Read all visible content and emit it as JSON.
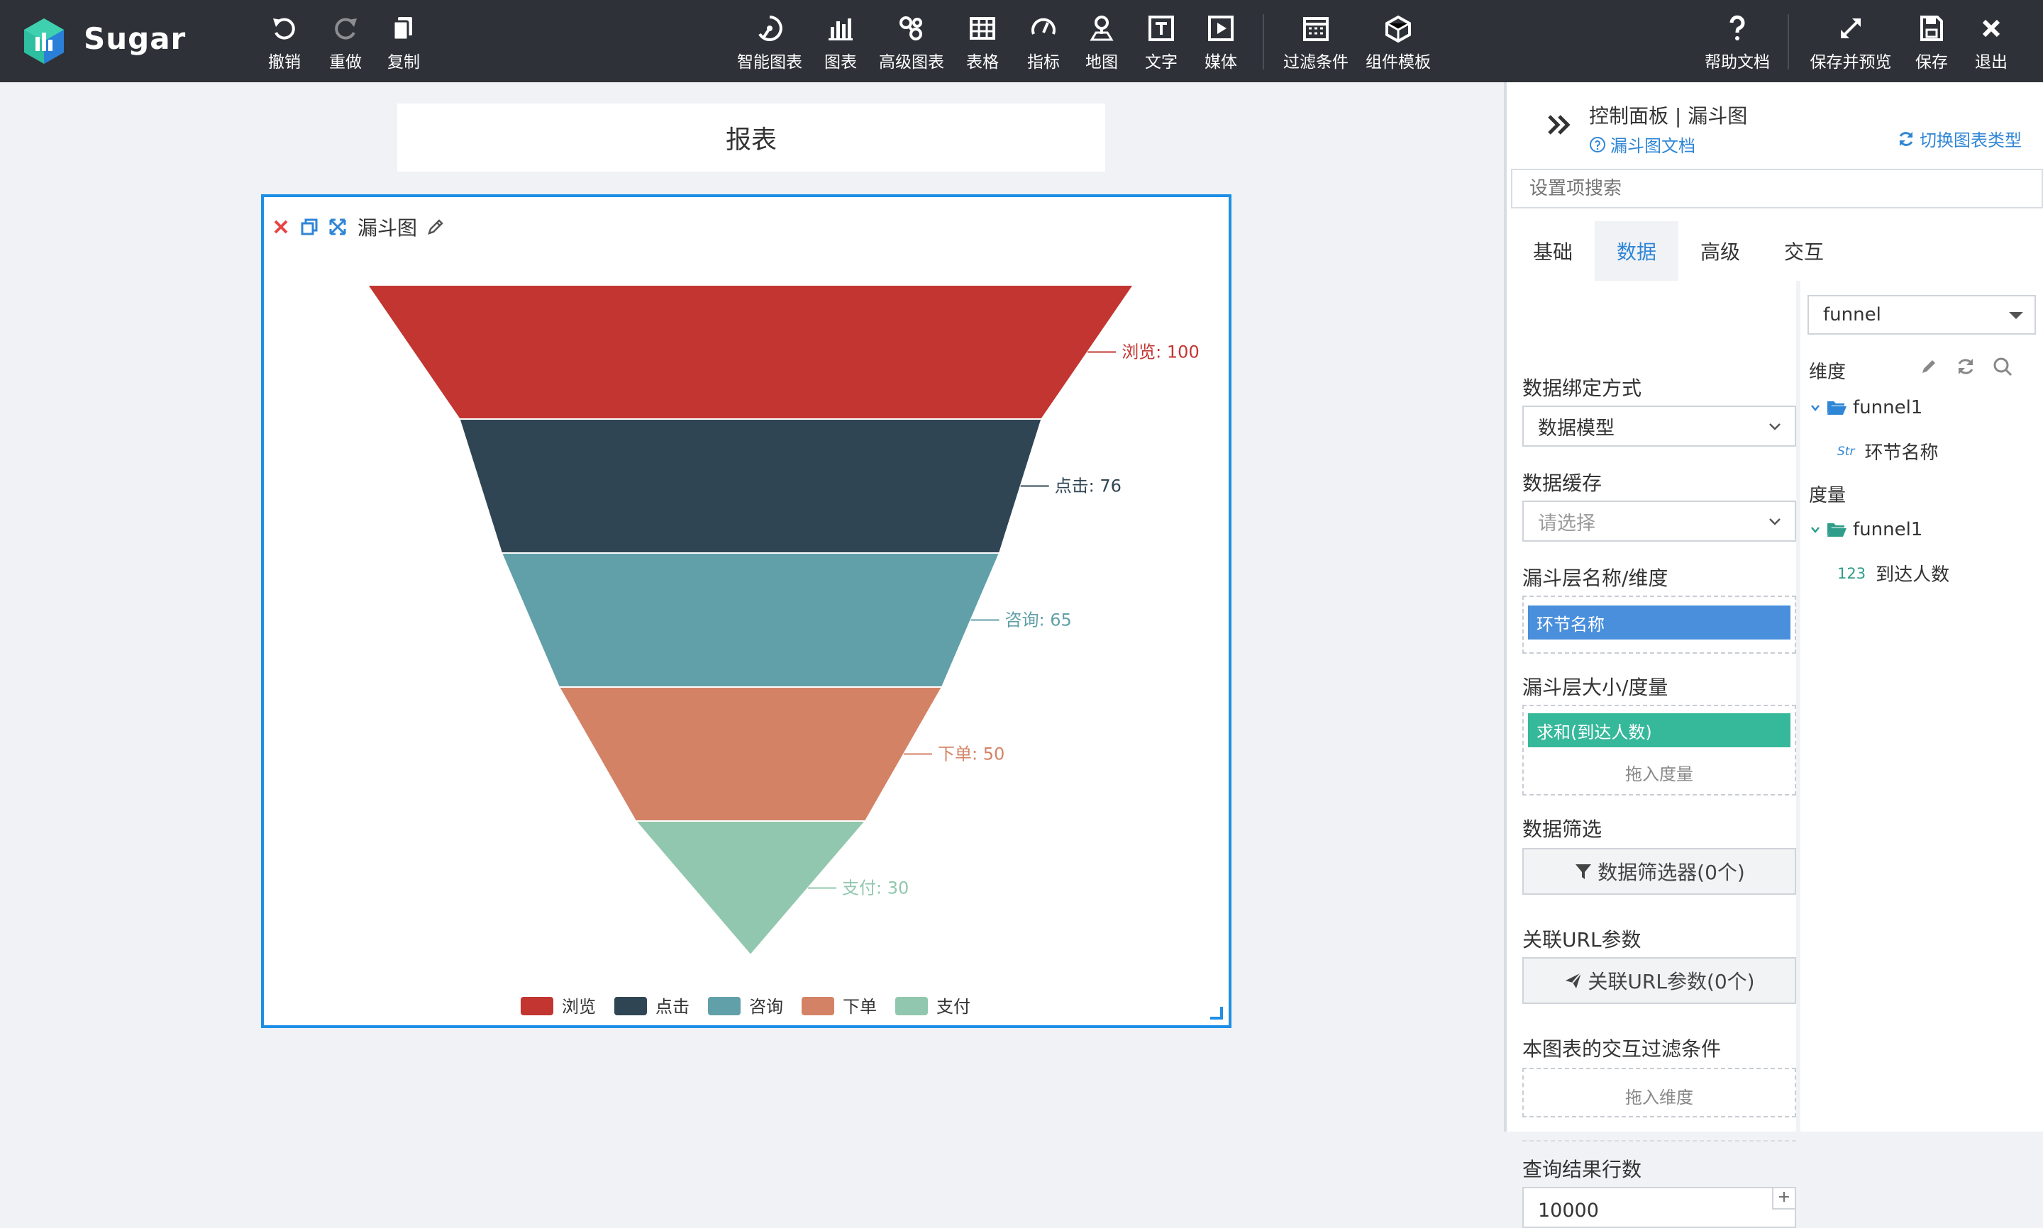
{
  "app": {
    "brand": "Sugar"
  },
  "toolbar": {
    "left": [
      {
        "id": "undo",
        "label": "撤销"
      },
      {
        "id": "redo",
        "label": "重做"
      },
      {
        "id": "copy",
        "label": "复制"
      }
    ],
    "center": [
      {
        "id": "smart-chart",
        "label": "智能图表"
      },
      {
        "id": "chart",
        "label": "图表"
      },
      {
        "id": "advanced-chart",
        "label": "高级图表"
      },
      {
        "id": "table",
        "label": "表格"
      },
      {
        "id": "indicator",
        "label": "指标"
      },
      {
        "id": "map",
        "label": "地图"
      },
      {
        "id": "text",
        "label": "文字"
      },
      {
        "id": "media",
        "label": "媒体"
      },
      {
        "id": "filter",
        "label": "过滤条件"
      },
      {
        "id": "template",
        "label": "组件模板"
      }
    ],
    "right": [
      {
        "id": "help",
        "label": "帮助文档"
      },
      {
        "id": "save-preview",
        "label": "保存并预览"
      },
      {
        "id": "save",
        "label": "保存"
      },
      {
        "id": "exit",
        "label": "退出"
      }
    ]
  },
  "canvas": {
    "report_title": "报表",
    "card": {
      "name": "漏斗图"
    }
  },
  "chart_data": {
    "type": "funnel",
    "categories": [
      "浏览",
      "点击",
      "咨询",
      "下单",
      "支付"
    ],
    "values": [
      100,
      76,
      65,
      50,
      30
    ],
    "labels": [
      "浏览: 100",
      "点击: 76",
      "咨询: 65",
      "下单: 50",
      "支付: 30"
    ],
    "colors": [
      "#c23531",
      "#2f4554",
      "#61a0a8",
      "#d48265",
      "#91c7ae"
    ],
    "legend": "bottom-center"
  },
  "panel": {
    "title": "控制面板 | 漏斗图",
    "doc_link": "漏斗图文档",
    "switch_type": "切换图表类型",
    "search_placeholder": "设置项搜索",
    "tabs": [
      "基础",
      "数据",
      "高级",
      "交互"
    ],
    "active_tab": "数据",
    "sections": {
      "binding_label": "数据绑定方式",
      "binding_value": "数据模型",
      "cache_label": "数据缓存",
      "cache_placeholder": "请选择",
      "layer_name_label": "漏斗层名称/维度",
      "layer_name_pill": "环节名称",
      "layer_size_label": "漏斗层大小/度量",
      "layer_size_pill": "求和(到达人数)",
      "drop_measure": "拖入度量",
      "filter_label": "数据筛选",
      "filter_button": "数据筛选器(0个)",
      "url_label": "关联URL参数",
      "url_button": "关联URL参数(0个)",
      "interaction_label": "本图表的交互过滤条件",
      "drop_dimension": "拖入维度",
      "rows_label": "查询结果行数",
      "rows_value": "10000"
    },
    "model": {
      "select_value": "funnel",
      "dimension_label": "维度",
      "measure_label": "度量",
      "dimension_folder": "funnel1",
      "dimension_field": "环节名称",
      "dimension_field_tag": "Str",
      "measure_folder": "funnel1",
      "measure_field": "到达人数",
      "measure_field_tag": "123"
    }
  }
}
